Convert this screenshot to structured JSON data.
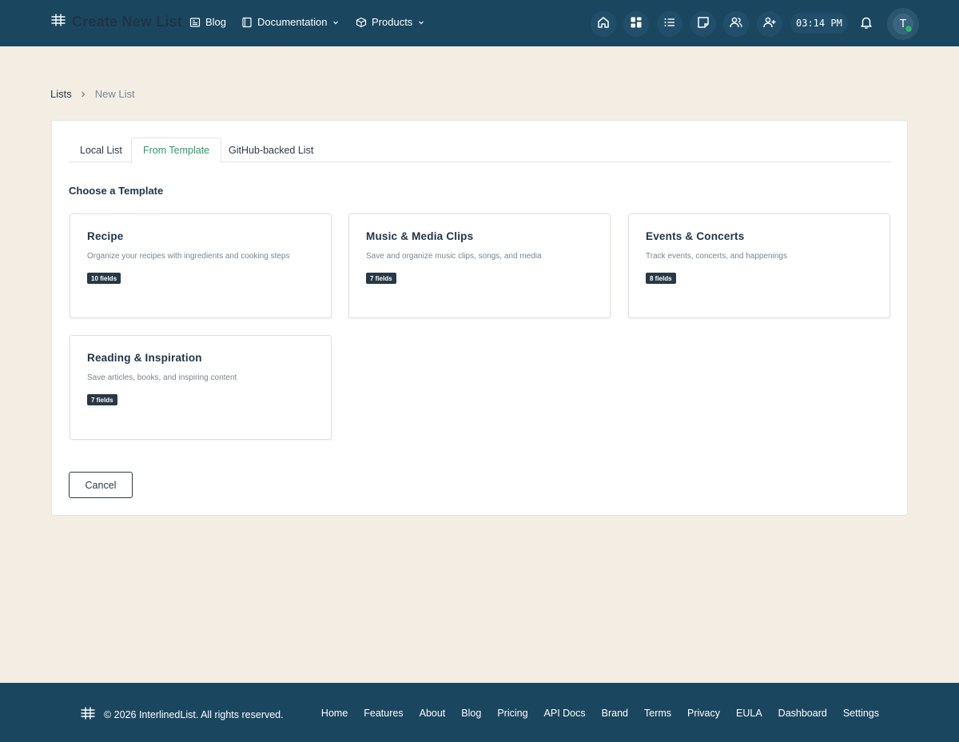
{
  "header": {
    "title": "Create New List",
    "nav": [
      {
        "label": "Blog",
        "icon": "newspaper-icon"
      },
      {
        "label": "Documentation",
        "icon": "book-icon"
      },
      {
        "label": "Products",
        "icon": "box-icon"
      }
    ],
    "icons": [
      "home-icon",
      "dashboard-icon",
      "list-icon",
      "sticky-note-icon",
      "users-icon",
      "user-plus-icon"
    ],
    "clock": "03:14 PM",
    "avatar_initial": "T"
  },
  "breadcrumb": {
    "root": "Lists",
    "current": "New List"
  },
  "tabs": [
    {
      "label": "Local List",
      "active": false
    },
    {
      "label": "From Template",
      "active": true
    },
    {
      "label": "GitHub-backed List",
      "active": false
    }
  ],
  "section_title": "Choose a Template",
  "templates": [
    {
      "name": "Recipe",
      "description": "Organize your recipes with ingredients and cooking steps",
      "fields": "10 fields"
    },
    {
      "name": "Music & Media Clips",
      "description": "Save and organize music clips, songs, and media",
      "fields": "7 fields"
    },
    {
      "name": "Events & Concerts",
      "description": "Track events, concerts, and happenings",
      "fields": "8 fields"
    },
    {
      "name": "Reading & Inspiration",
      "description": "Save articles, books, and inspiring content",
      "fields": "7 fields"
    }
  ],
  "cancel_label": "Cancel",
  "footer": {
    "copyright": "© 2026 InterlinedList. All rights reserved.",
    "links": [
      "Home",
      "Features",
      "About",
      "Blog",
      "Pricing",
      "API Docs",
      "Brand",
      "Terms",
      "Privacy",
      "EULA",
      "Dashboard",
      "Settings"
    ]
  },
  "colors": {
    "header_bg": "#1b4660",
    "page_bg": "#f4ede3",
    "accent": "#2a9a6a",
    "badge_bg": "#283845"
  }
}
